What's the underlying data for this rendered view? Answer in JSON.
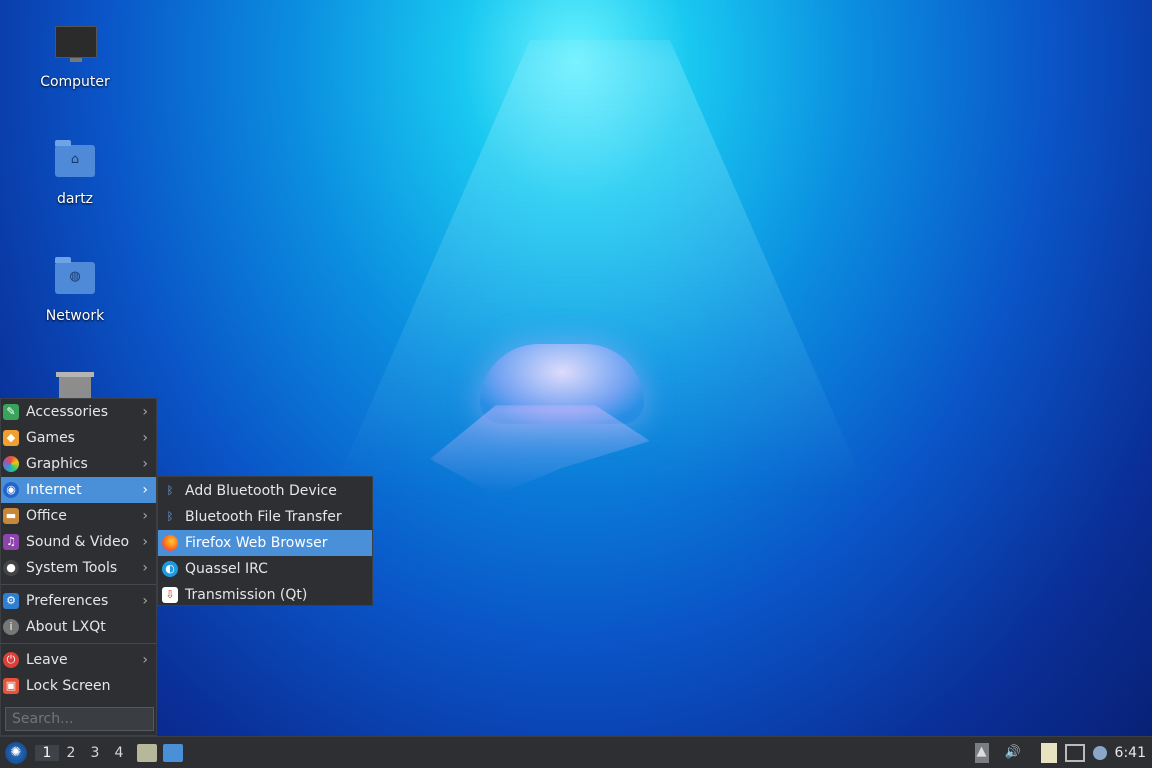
{
  "desktop": {
    "icons": [
      {
        "label": "Computer"
      },
      {
        "label": "dartz"
      },
      {
        "label": "Network"
      }
    ]
  },
  "menu": {
    "items": [
      {
        "label": "Accessories"
      },
      {
        "label": "Games"
      },
      {
        "label": "Graphics"
      },
      {
        "label": "Internet"
      },
      {
        "label": "Office"
      },
      {
        "label": "Sound & Video"
      },
      {
        "label": "System Tools"
      },
      {
        "label": "Preferences"
      },
      {
        "label": "About LXQt"
      },
      {
        "label": "Leave"
      },
      {
        "label": "Lock Screen"
      }
    ],
    "search_placeholder": "Search..."
  },
  "submenu": {
    "items": [
      {
        "label": "Add Bluetooth Device"
      },
      {
        "label": "Bluetooth File Transfer"
      },
      {
        "label": "Firefox Web Browser"
      },
      {
        "label": "Quassel IRC"
      },
      {
        "label": "Transmission (Qt)"
      }
    ]
  },
  "taskbar": {
    "workspaces": [
      "1",
      "2",
      "3",
      "4"
    ],
    "clock": "6:41"
  },
  "icons": {
    "accent": "#4a90d9"
  }
}
